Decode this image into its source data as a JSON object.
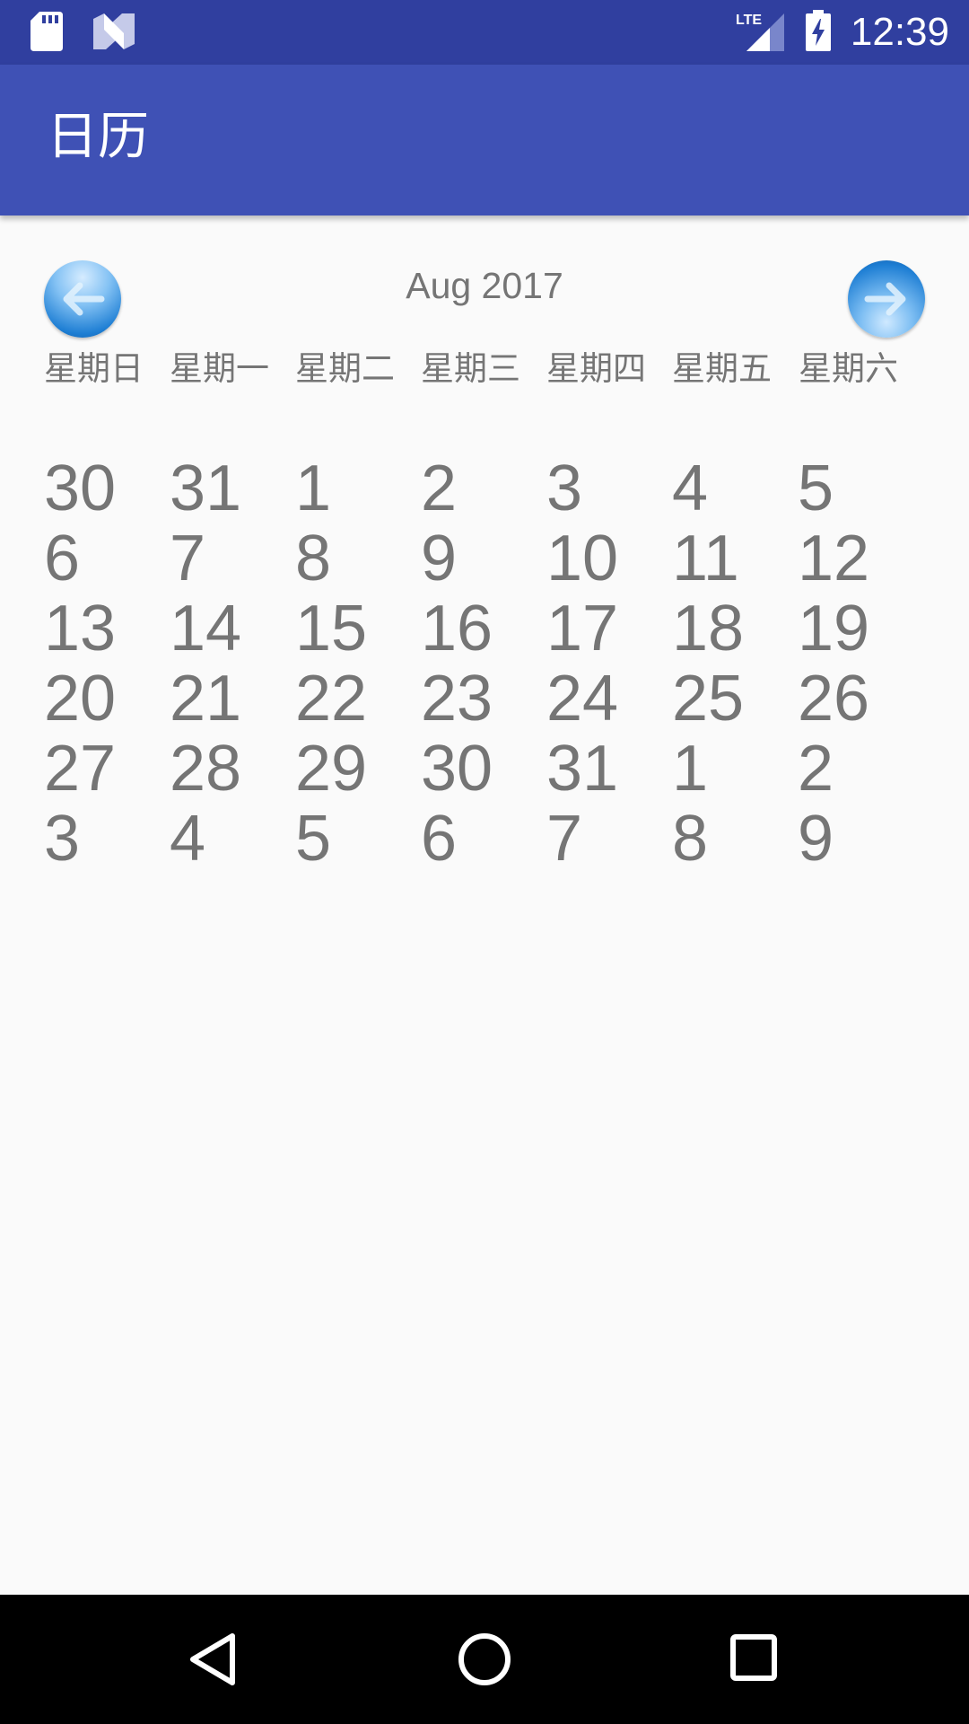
{
  "status_bar": {
    "time": "12:39",
    "icons": [
      "sd-card-icon",
      "n-logo-icon",
      "lte-signal-icon",
      "battery-charging-icon"
    ],
    "network_label": "LTE"
  },
  "app_bar": {
    "title": "日历"
  },
  "calendar": {
    "month_label": "Aug 2017",
    "prev_icon": "arrow-left-icon",
    "next_icon": "arrow-right-icon",
    "weekdays": [
      "星期日",
      "星期一",
      "星期二",
      "星期三",
      "星期四",
      "星期五",
      "星期六"
    ],
    "weeks": [
      [
        "30",
        "31",
        "1",
        "2",
        "3",
        "4",
        "5"
      ],
      [
        "6",
        "7",
        "8",
        "9",
        "10",
        "11",
        "12"
      ],
      [
        "13",
        "14",
        "15",
        "16",
        "17",
        "18",
        "19"
      ],
      [
        "20",
        "21",
        "22",
        "23",
        "24",
        "25",
        "26"
      ],
      [
        "27",
        "28",
        "29",
        "30",
        "31",
        "1",
        "2"
      ],
      [
        "3",
        "4",
        "5",
        "6",
        "7",
        "8",
        "9"
      ]
    ]
  },
  "nav_bar": {
    "icons": [
      "back-icon",
      "home-icon",
      "recents-icon"
    ]
  },
  "colors": {
    "status_bar": "#303f9f",
    "app_bar": "#3f51b5",
    "text_gray": "#757575",
    "background": "#fafafa"
  }
}
